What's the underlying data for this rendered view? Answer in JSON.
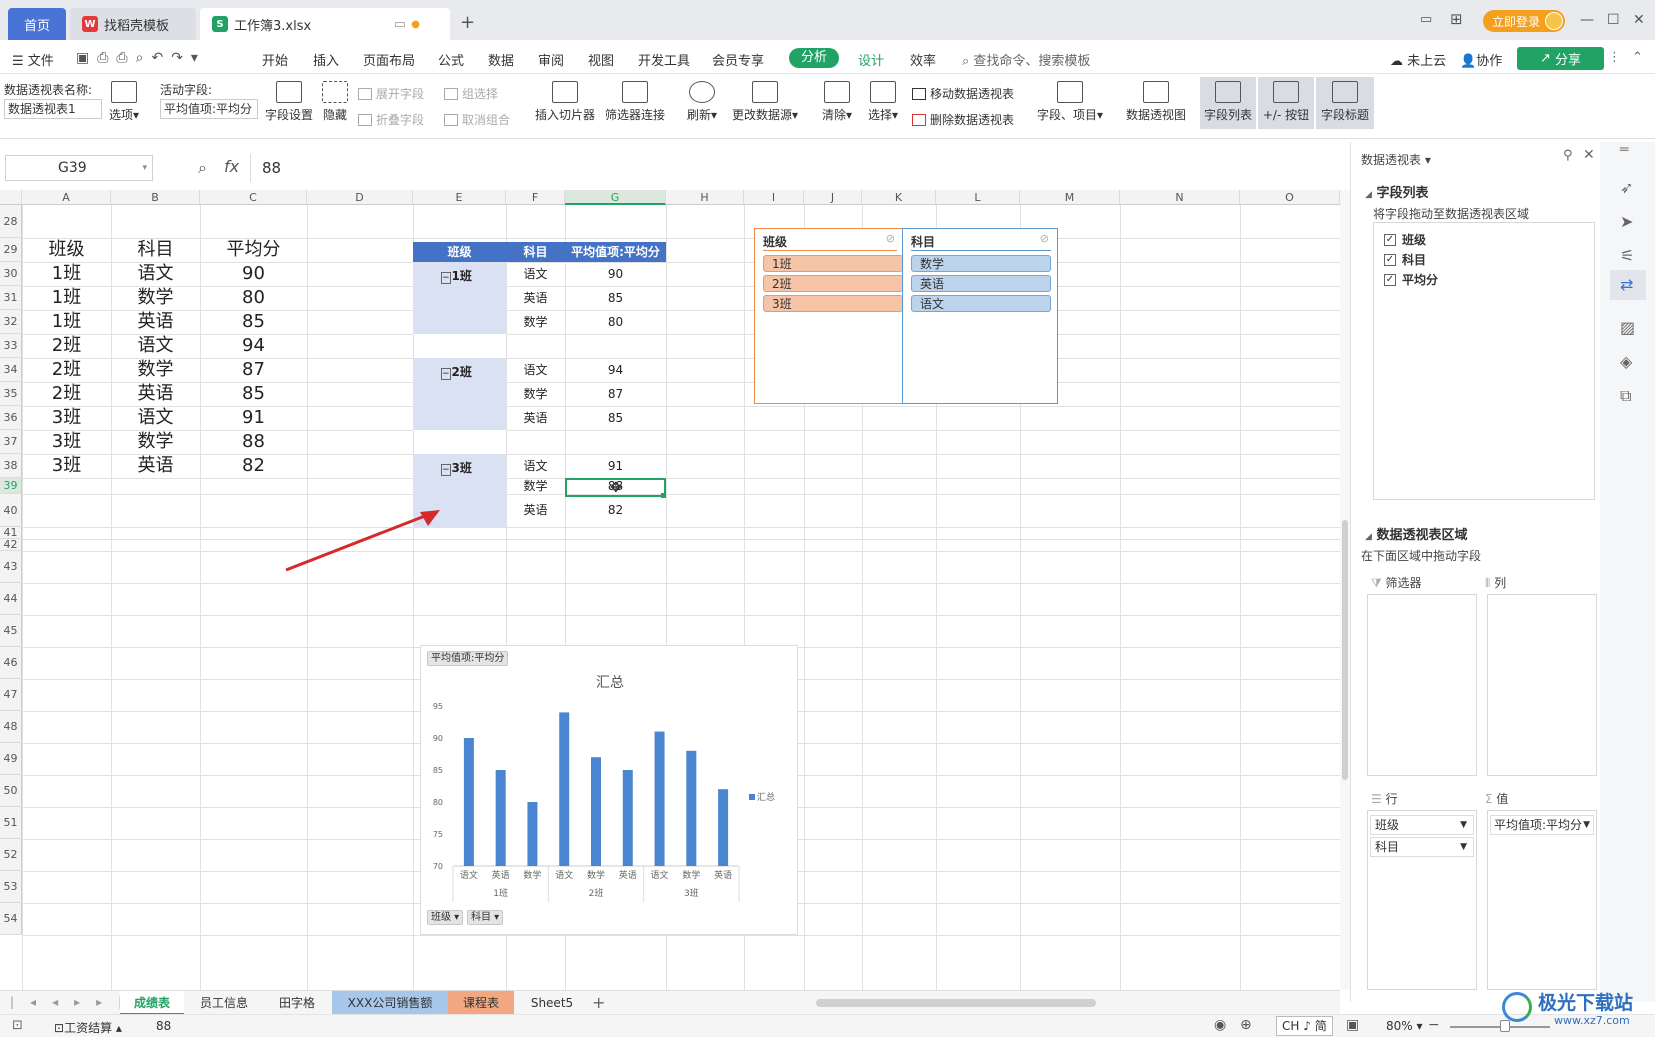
{
  "titlebar": {
    "tabs": [
      {
        "label": "首页"
      },
      {
        "label": "找稻壳模板"
      },
      {
        "label": "工作簿3.xlsx"
      }
    ],
    "login_label": "立即登录"
  },
  "menubar": {
    "file_label": "文件",
    "items": [
      "开始",
      "插入",
      "页面布局",
      "公式",
      "数据",
      "审阅",
      "视图",
      "开发工具",
      "会员专享",
      "分析",
      "设计",
      "效率"
    ],
    "search_placeholder": "查找命令、搜索模板",
    "cloud_label": "未上云",
    "collab_label": "协作",
    "share_label": "分享"
  },
  "ribbon": {
    "pivot_name_label": "数据透视表名称:",
    "pivot_name_value": "数据透视表1",
    "options_label": "选项",
    "active_field_label": "活动字段:",
    "active_field_value": "平均值项:平均分",
    "field_settings": "字段设置",
    "hide": "隐藏",
    "expand_field": "展开字段",
    "collapse_field": "折叠字段",
    "group_select": "组选择",
    "ungroup": "取消组合",
    "insert_slicer": "插入切片器",
    "filter_conn": "筛选器连接",
    "refresh": "刷新",
    "change_source": "更改数据源",
    "clear": "清除",
    "select": "选择",
    "move_pivot": "移动数据透视表",
    "delete_pivot": "删除数据透视表",
    "fields_items": "字段、项目",
    "pivot_chart": "数据透视图",
    "field_list": "字段列表",
    "plus_minus": "+/- 按钮",
    "field_headers": "字段标题"
  },
  "formula": {
    "cell_ref": "G39",
    "value": "88"
  },
  "columns": [
    "A",
    "B",
    "C",
    "D",
    "E",
    "F",
    "G",
    "H",
    "I",
    "J",
    "K",
    "L",
    "M",
    "N",
    "O"
  ],
  "rows": [
    "28",
    "29",
    "30",
    "31",
    "32",
    "33",
    "34",
    "35",
    "36",
    "37",
    "38",
    "39",
    "40",
    "41",
    "42",
    "43",
    "44",
    "45",
    "46",
    "47",
    "48",
    "49",
    "50",
    "51",
    "52",
    "53",
    "54"
  ],
  "source_table": {
    "headers": [
      "班级",
      "科目",
      "平均分"
    ],
    "rows": [
      [
        "1班",
        "语文",
        "90"
      ],
      [
        "1班",
        "数学",
        "80"
      ],
      [
        "1班",
        "英语",
        "85"
      ],
      [
        "2班",
        "语文",
        "94"
      ],
      [
        "2班",
        "数学",
        "87"
      ],
      [
        "2班",
        "英语",
        "85"
      ],
      [
        "3班",
        "语文",
        "91"
      ],
      [
        "3班",
        "数学",
        "88"
      ],
      [
        "3班",
        "英语",
        "82"
      ]
    ]
  },
  "pivot": {
    "headers": [
      "班级",
      "科目",
      "平均值项:平均分"
    ],
    "groups": [
      {
        "label": "1班",
        "items": [
          [
            "语文",
            "90"
          ],
          [
            "英语",
            "85"
          ],
          [
            "数学",
            "80"
          ]
        ]
      },
      {
        "label": "2班",
        "items": [
          [
            "语文",
            "94"
          ],
          [
            "数学",
            "87"
          ],
          [
            "英语",
            "85"
          ]
        ]
      },
      {
        "label": "3班",
        "items": [
          [
            "语文",
            "91"
          ],
          [
            "数学",
            "88"
          ],
          [
            "英语",
            "82"
          ]
        ]
      }
    ]
  },
  "slicers": {
    "class": {
      "title": "班级",
      "items": [
        "1班",
        "2班",
        "3班"
      ],
      "color": "#f6c4a6"
    },
    "subject": {
      "title": "科目",
      "items": [
        "数学",
        "英语",
        "语文"
      ],
      "color": "#bcd3ec"
    }
  },
  "chart_data": {
    "type": "bar",
    "title": "汇总",
    "value_button": "平均值项:平均分",
    "filter_buttons": [
      "班级",
      "科目"
    ],
    "categories": [
      "语文",
      "英语",
      "数学",
      "语文",
      "数学",
      "英语",
      "语文",
      "数学",
      "英语"
    ],
    "groups": [
      "1班",
      "2班",
      "3班"
    ],
    "series": [
      {
        "name": "汇总",
        "values": [
          90,
          85,
          80,
          94,
          87,
          85,
          91,
          88,
          82
        ],
        "color": "#4a86d0"
      }
    ],
    "ylim": [
      70,
      95
    ],
    "yticks": [
      "95",
      "90",
      "85",
      "80",
      "75",
      "70"
    ],
    "legend_position": "right"
  },
  "panel": {
    "title": "数据透视表",
    "field_list_title": "字段列表",
    "field_hint": "将字段拖动至数据透视表区域",
    "fields": [
      "班级",
      "科目",
      "平均分"
    ],
    "area_title": "数据透视表区域",
    "area_hint": "在下面区域中拖动字段",
    "filter_label": "筛选器",
    "column_label": "列",
    "row_label": "行",
    "value_label": "值",
    "row_fields": [
      "班级",
      "科目"
    ],
    "value_fields": [
      "平均值项:平均分"
    ]
  },
  "sheets": [
    "成绩表",
    "员工信息",
    "田字格",
    "XXX公司销售额",
    "课程表",
    "Sheet5"
  ],
  "status": {
    "macro_label": "工资结算",
    "cell_value": "88",
    "ime": "CH ♪ 简",
    "zoom": "80%"
  },
  "watermark": {
    "name": "极光下载站",
    "url": "www.xz7.com"
  }
}
